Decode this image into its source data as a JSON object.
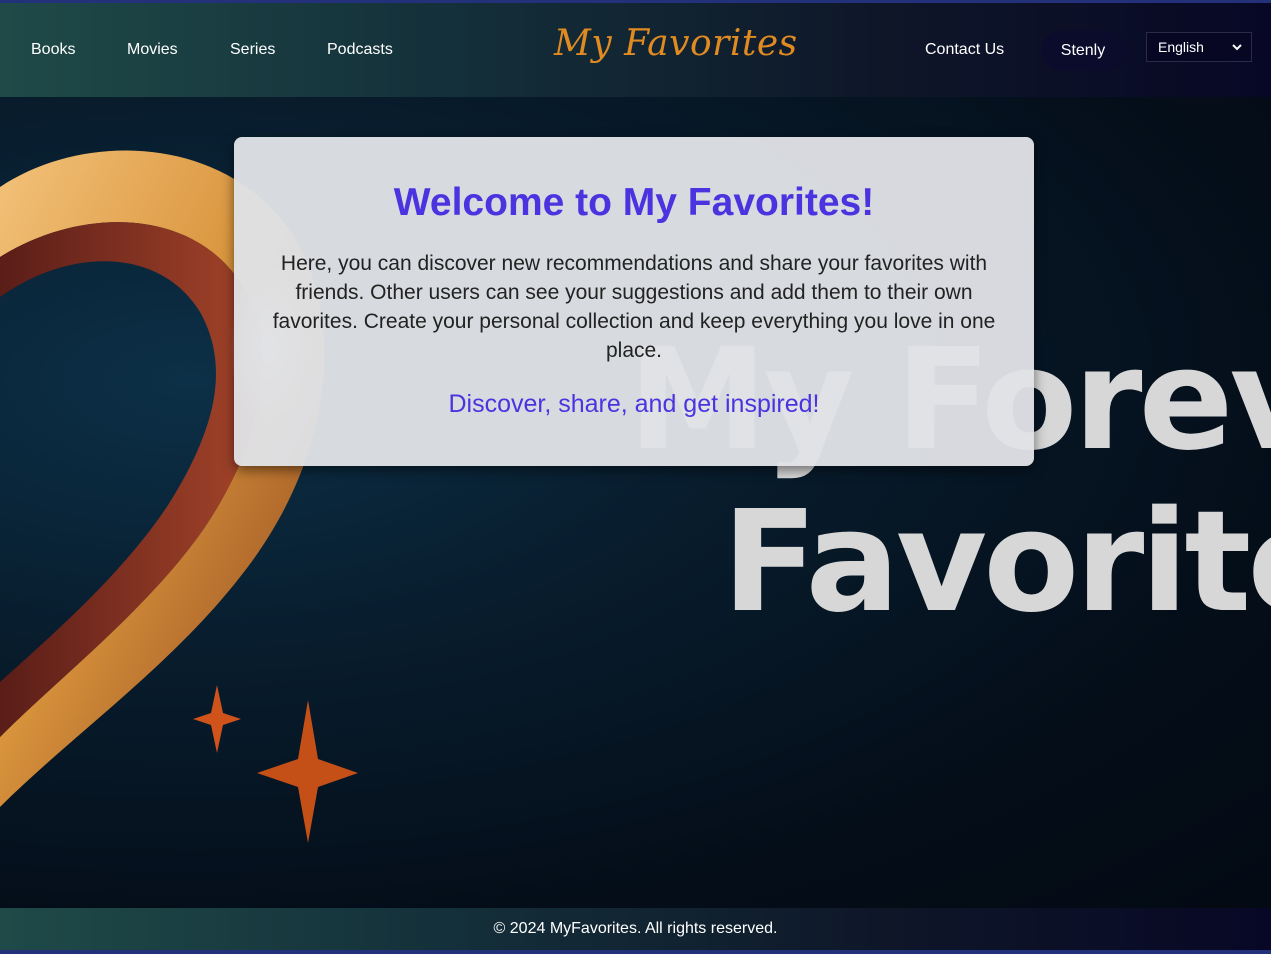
{
  "nav": {
    "links": [
      "Books",
      "Movies",
      "Series",
      "Podcasts"
    ],
    "logo": "My Favorites",
    "contact": "Contact Us",
    "user": "Stenly",
    "language": "English"
  },
  "hero": {
    "background_text_line1": "My Foreve",
    "background_text_line2": "Favorites"
  },
  "welcome": {
    "title": "Welcome to My Favorites!",
    "body": "Here, you can discover new recommendations and share your favorites with friends. Other users can see your suggestions and add them to their own favorites. Create your personal collection and keep everything you love in one place.",
    "tagline": "Discover, share, and get inspired!"
  },
  "footer": {
    "copyright": "© 2024 MyFavorites. All rights reserved."
  },
  "colors": {
    "accent": "#4b33e0",
    "logo": "#e08a22",
    "nav_start": "#1f4a48",
    "nav_end": "#080826"
  }
}
